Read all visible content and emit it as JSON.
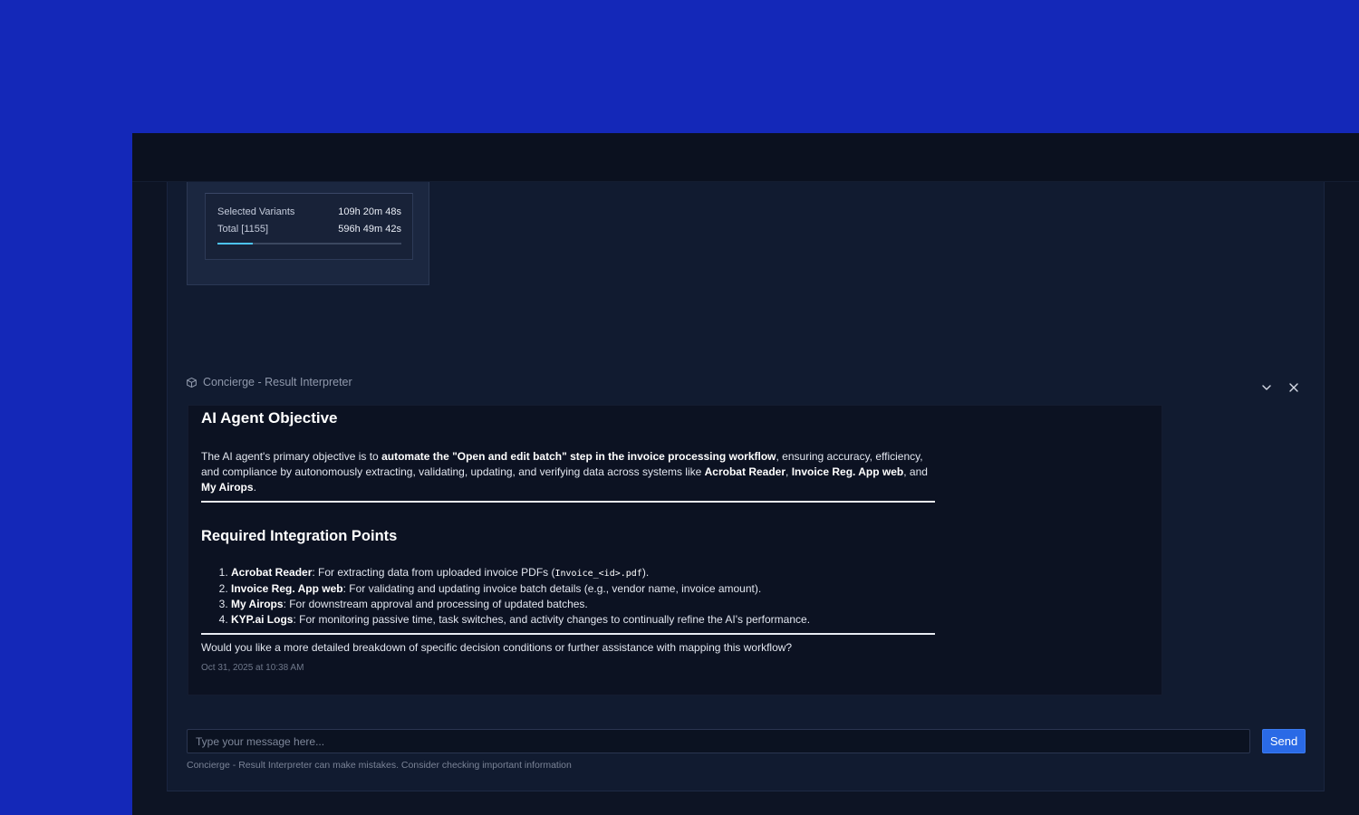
{
  "stats": {
    "rows": [
      {
        "label": "Selected Variants",
        "value": "109h 20m 48s"
      },
      {
        "label": "Total [1155]",
        "value": "596h 49m 42s"
      }
    ],
    "progress_fraction": 0.19
  },
  "chat": {
    "header_title": "Concierge - Result Interpreter",
    "header_icon": "cube-icon",
    "message": {
      "heading1": "AI Agent Objective",
      "p1_parts": [
        {
          "t": "The AI agent's primary objective is to ",
          "b": false
        },
        {
          "t": "automate the \"Open and edit batch\" step in the invoice processing workflow",
          "b": true
        },
        {
          "t": ", ensuring accuracy, efficiency, and compliance by autonomously extracting, validating, updating, and verifying data across systems like ",
          "b": false
        },
        {
          "t": "Acrobat Reader",
          "b": true
        },
        {
          "t": ", ",
          "b": false
        },
        {
          "t": "Invoice Reg. App web",
          "b": true
        },
        {
          "t": ", and ",
          "b": false
        },
        {
          "t": "My Airops",
          "b": true
        },
        {
          "t": ".",
          "b": false
        }
      ],
      "heading2": "Required Integration Points",
      "list": [
        {
          "name": "Acrobat Reader",
          "text": ": For extracting data from uploaded invoice PDFs (",
          "code": "Invoice_<id>.pdf",
          "after": ")."
        },
        {
          "name": "Invoice Reg. App web",
          "text": ": For validating and updating invoice batch details (e.g., vendor name, invoice amount).",
          "code": "",
          "after": ""
        },
        {
          "name": "My Airops",
          "text": ": For downstream approval and processing of updated batches.",
          "code": "",
          "after": ""
        },
        {
          "name": "KYP.ai Logs",
          "text": ": For monitoring passive time, task switches, and activity changes to continually refine the AI's performance.",
          "code": "",
          "after": ""
        }
      ],
      "question": "Would you like a more detailed breakdown of specific decision conditions or further assistance with mapping this workflow?",
      "timestamp": "Oct 31, 2025 at 10:38 AM"
    },
    "input_placeholder": "Type your message here...",
    "send_label": "Send",
    "disclaimer": "Concierge - Result Interpreter can make mistakes. Consider checking important information"
  },
  "colors": {
    "background": "#1428b8",
    "accent": "#2a6ae6",
    "progress": "#4cc3f5"
  }
}
